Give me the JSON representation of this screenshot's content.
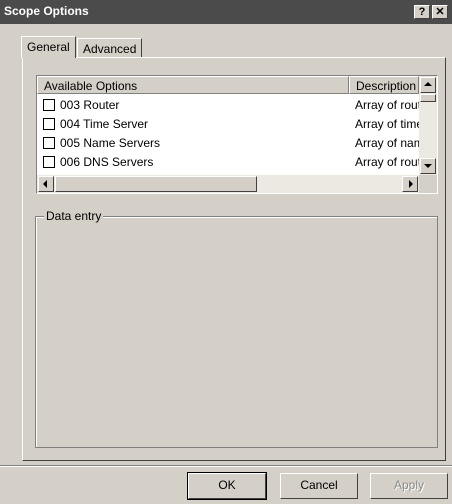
{
  "window": {
    "title": "Scope Options",
    "help_glyph": "?",
    "close_glyph": "✕"
  },
  "tabs": [
    {
      "label": "General",
      "selected": true
    },
    {
      "label": "Advanced",
      "selected": false
    }
  ],
  "options_list": {
    "headers": [
      "Available Options",
      "Description"
    ],
    "rows": [
      {
        "checked": false,
        "option": "003 Router",
        "description": "Array of rout"
      },
      {
        "checked": false,
        "option": "004 Time Server",
        "description": "Array of time"
      },
      {
        "checked": false,
        "option": "005 Name Servers",
        "description": "Array of nam"
      },
      {
        "checked": false,
        "option": "006 DNS Servers",
        "description": "Array of rout"
      }
    ]
  },
  "data_entry": {
    "title": "Data entry"
  },
  "buttons": {
    "ok": "OK",
    "cancel": "Cancel",
    "apply": "Apply",
    "apply_enabled": false
  },
  "colors": {
    "titlebar": "#4b4b4b",
    "dialog_face": "#d4d0c8",
    "disabled_text": "#8a8a8a"
  }
}
